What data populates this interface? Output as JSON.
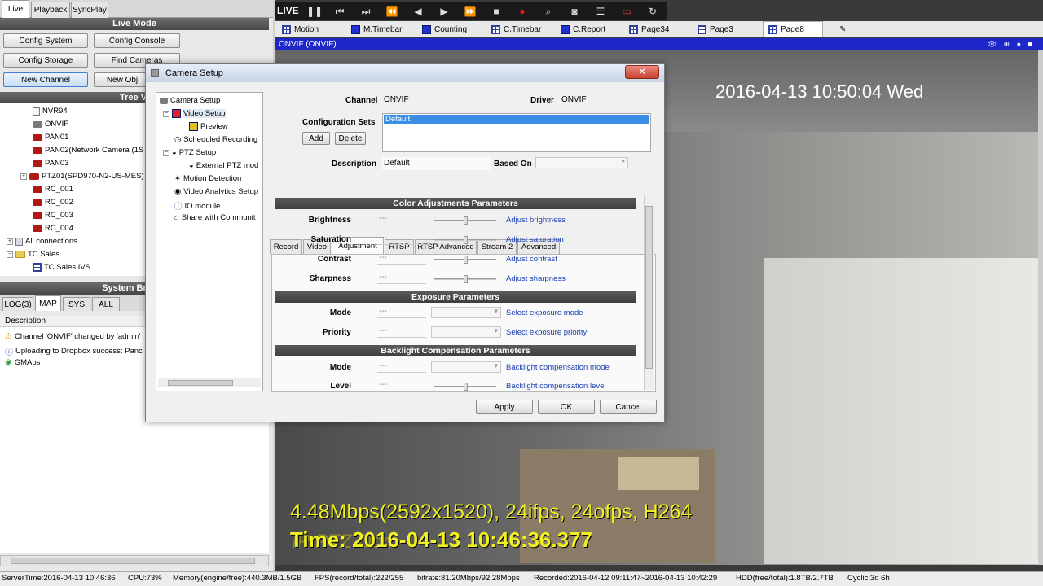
{
  "left_tabs": [
    "Live",
    "Playback",
    "SyncPlay"
  ],
  "live_mode": {
    "header": "Live Mode",
    "buttons": [
      "Config System",
      "Config Console",
      "Config Storage",
      "Find Cameras",
      "New Channel",
      "New Obj"
    ]
  },
  "tree": {
    "header": "Tree Vi",
    "items": [
      "NVR94",
      "ONVIF",
      "PAN01",
      "PAN02(Network Camera (1S",
      "PAN03",
      "PTZ01(SPD970-N2-US-MES)",
      "RC_001",
      "RC_002",
      "RC_003",
      "RC_004",
      "All connections",
      "TC.Sales",
      "TC.Sales.IVS"
    ]
  },
  "briefcase": {
    "header": "System Briefca",
    "tabs": [
      "LOG(3)",
      "MAP",
      "SYS",
      "ALL"
    ],
    "column": "Description",
    "rows": [
      "Channel 'ONVIF' changed by 'admin'",
      "Uploading to Dropbox success: Panc",
      "GMAps"
    ]
  },
  "toolbar": {
    "live_label": "LIVE",
    "icons": [
      "pause-icon",
      "step-back-icon",
      "step-forward-icon",
      "fast-rewind-icon",
      "play-back-icon",
      "play-icon",
      "fast-forward-icon",
      "stop-icon",
      "record-icon",
      "zoom-icon",
      "snapshot-icon",
      "list-icon",
      "display-icon",
      "refresh-icon"
    ]
  },
  "page_tabs": [
    "Motion",
    "M.Timebar",
    "Counting",
    "C.Timebar",
    "C.Report",
    "Page34",
    "Page3",
    "Page8"
  ],
  "camera_title": "ONVIF (ONVIF)",
  "overlay": {
    "timestamp": "2016-04-13 10:50:04 Wed",
    "stats": "4.48Mbps(2592x1520), 24ifps, 24ofps, H264",
    "time_label": "Time: 2016-04-13 10:46:36.377",
    "faint": "IP PTZ Dom"
  },
  "dialog": {
    "title": "Camera Setup",
    "nav": [
      "Camera Setup",
      "Video Setup",
      "Preview",
      "Scheduled Recording",
      "PTZ Setup",
      "External PTZ mod",
      "Motion Detection",
      "Video Analytics Setup",
      "IO module",
      "Share with Communit"
    ],
    "channel_label": "Channel",
    "channel_value": "ONVIF",
    "driver_label": "Driver",
    "driver_value": "ONVIF",
    "config_sets_label": "Configuration Sets",
    "config_sets": [
      "Default"
    ],
    "add_label": "Add",
    "delete_label": "Delete",
    "description_label": "Description",
    "description_value": "Default",
    "based_on_label": "Based On",
    "tabs": [
      "Record",
      "Video",
      "Adjustment",
      "RTSP",
      "RTSP Advanced",
      "Stream 2",
      "Advanced"
    ],
    "active_tab": "Adjustment",
    "sections": [
      {
        "title": "Color Adjustments Parameters",
        "params": [
          {
            "label": "Brightness",
            "value": "---",
            "control": "slider",
            "hint": "Adjust brightness"
          },
          {
            "label": "Saturation",
            "value": "---",
            "control": "slider",
            "hint": "Adjust saturation"
          },
          {
            "label": "Contrast",
            "value": "---",
            "control": "slider",
            "hint": "Adjust contrast"
          },
          {
            "label": "Sharpness",
            "value": "---",
            "control": "slider",
            "hint": "Adjust sharpness"
          }
        ]
      },
      {
        "title": "Exposure Parameters",
        "params": [
          {
            "label": "Mode",
            "value": "---",
            "control": "combo",
            "hint": "Select exposure mode"
          },
          {
            "label": "Priority",
            "value": "---",
            "control": "combo",
            "hint": "Select exposure priority"
          }
        ]
      },
      {
        "title": "Backlight Compensation Parameters",
        "params": [
          {
            "label": "Mode",
            "value": "---",
            "control": "combo",
            "hint": "Backlight compensation mode"
          },
          {
            "label": "Level",
            "value": "---",
            "control": "slider",
            "hint": "Backlight compensation level"
          }
        ]
      }
    ],
    "apply_label": "Apply",
    "ok_label": "OK",
    "cancel_label": "Cancel"
  },
  "status_bar": [
    "ServerTime:2016-04-13 10:46:36",
    "CPU:73%",
    "Memory(engine/free):440.3MB/1.5GB",
    "FPS(record/total):222/255",
    "bitrate:81.20Mbps/92.28Mbps",
    "Recorded:2016-04-12 09:11:47~2016-04-13 10:42:29",
    "HDD(free/total):1.8TB/2.7TB",
    "Cyclic:3d 6h"
  ]
}
